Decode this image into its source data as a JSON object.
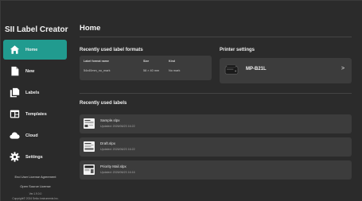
{
  "app": {
    "title": "SII Label Creator"
  },
  "window_controls": {
    "help": "?",
    "minimize": "—",
    "maximize": "□",
    "close": "✕"
  },
  "sidebar": {
    "items": [
      {
        "label": "Home",
        "icon": "home-icon",
        "active": true
      },
      {
        "label": "New",
        "icon": "new-document-icon",
        "active": false
      },
      {
        "label": "Labels",
        "icon": "labels-icon",
        "active": false
      },
      {
        "label": "Templates",
        "icon": "templates-icon",
        "active": false
      },
      {
        "label": "Cloud",
        "icon": "cloud-icon",
        "active": false
      },
      {
        "label": "Settings",
        "icon": "gear-icon",
        "active": false
      }
    ],
    "eula": "End User License Agreement",
    "open_source": "Open Source License",
    "version": "Ver.1.9.0.0",
    "copyright": "Copyright© 2024 Seiko Instruments Inc."
  },
  "main": {
    "title": "Home",
    "formats": {
      "title": "Recently used label formats",
      "headers": [
        "Label format name",
        "Size",
        "Kind"
      ],
      "rows": [
        [
          "54x40mm_no_mark",
          "58 × 40 mm",
          "No mark"
        ]
      ]
    },
    "printer": {
      "title": "Printer settings",
      "name": "MP-B21L",
      "arrow": ">"
    },
    "labels": {
      "title": "Recently used labels",
      "items": [
        {
          "name": "Sample.slpx",
          "updated": "Updated: 2026/06/23 16:22"
        },
        {
          "name": "Draft.slpx",
          "updated": "Updated: 2026/06/23 16:22"
        },
        {
          "name": "Priority Mail.slpx",
          "updated": "Updated: 2026/06/23 16:16"
        }
      ]
    }
  },
  "colors": {
    "accent": "#219b8f",
    "background": "#2b2b2b",
    "card": "#3c3c3c"
  }
}
